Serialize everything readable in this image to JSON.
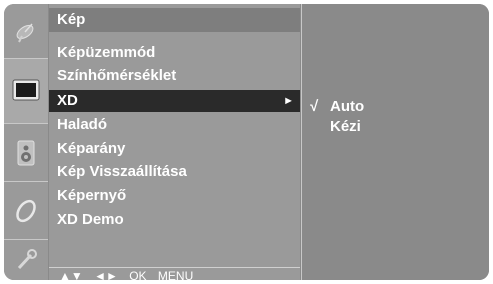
{
  "sidebar": {
    "icons": [
      {
        "name": "satellite-dish-icon"
      },
      {
        "name": "picture-screen-icon",
        "active": true
      },
      {
        "name": "speaker-icon"
      },
      {
        "name": "clock-icon"
      },
      {
        "name": "settings-wrench-icon"
      }
    ]
  },
  "menu": {
    "title": "Kép",
    "items": [
      {
        "label": "Képüzemmód"
      },
      {
        "label": "Színhőmérséklet"
      },
      {
        "label": "XD",
        "selected": true,
        "arrow": "►"
      },
      {
        "label": "Haladó"
      },
      {
        "label": "Képarány"
      },
      {
        "label": "Kép Visszaállítása"
      },
      {
        "label": "Képernyő"
      },
      {
        "label": "XD Demo"
      }
    ],
    "hint": {
      "updown": "▲▼",
      "leftright": "◄►",
      "ok": "OK",
      "menu": "MENU"
    }
  },
  "submenu": {
    "options": [
      {
        "label": "Auto",
        "check": "√",
        "checked": true
      },
      {
        "label": "Kézi",
        "check": "",
        "checked": false
      }
    ]
  },
  "colors": {
    "panel": "#8a8a8a",
    "menu_bg": "#9a9a9a",
    "title_bg": "#7e7e7e",
    "selected_bg": "#2a2a2a",
    "text": "#ffffff"
  }
}
